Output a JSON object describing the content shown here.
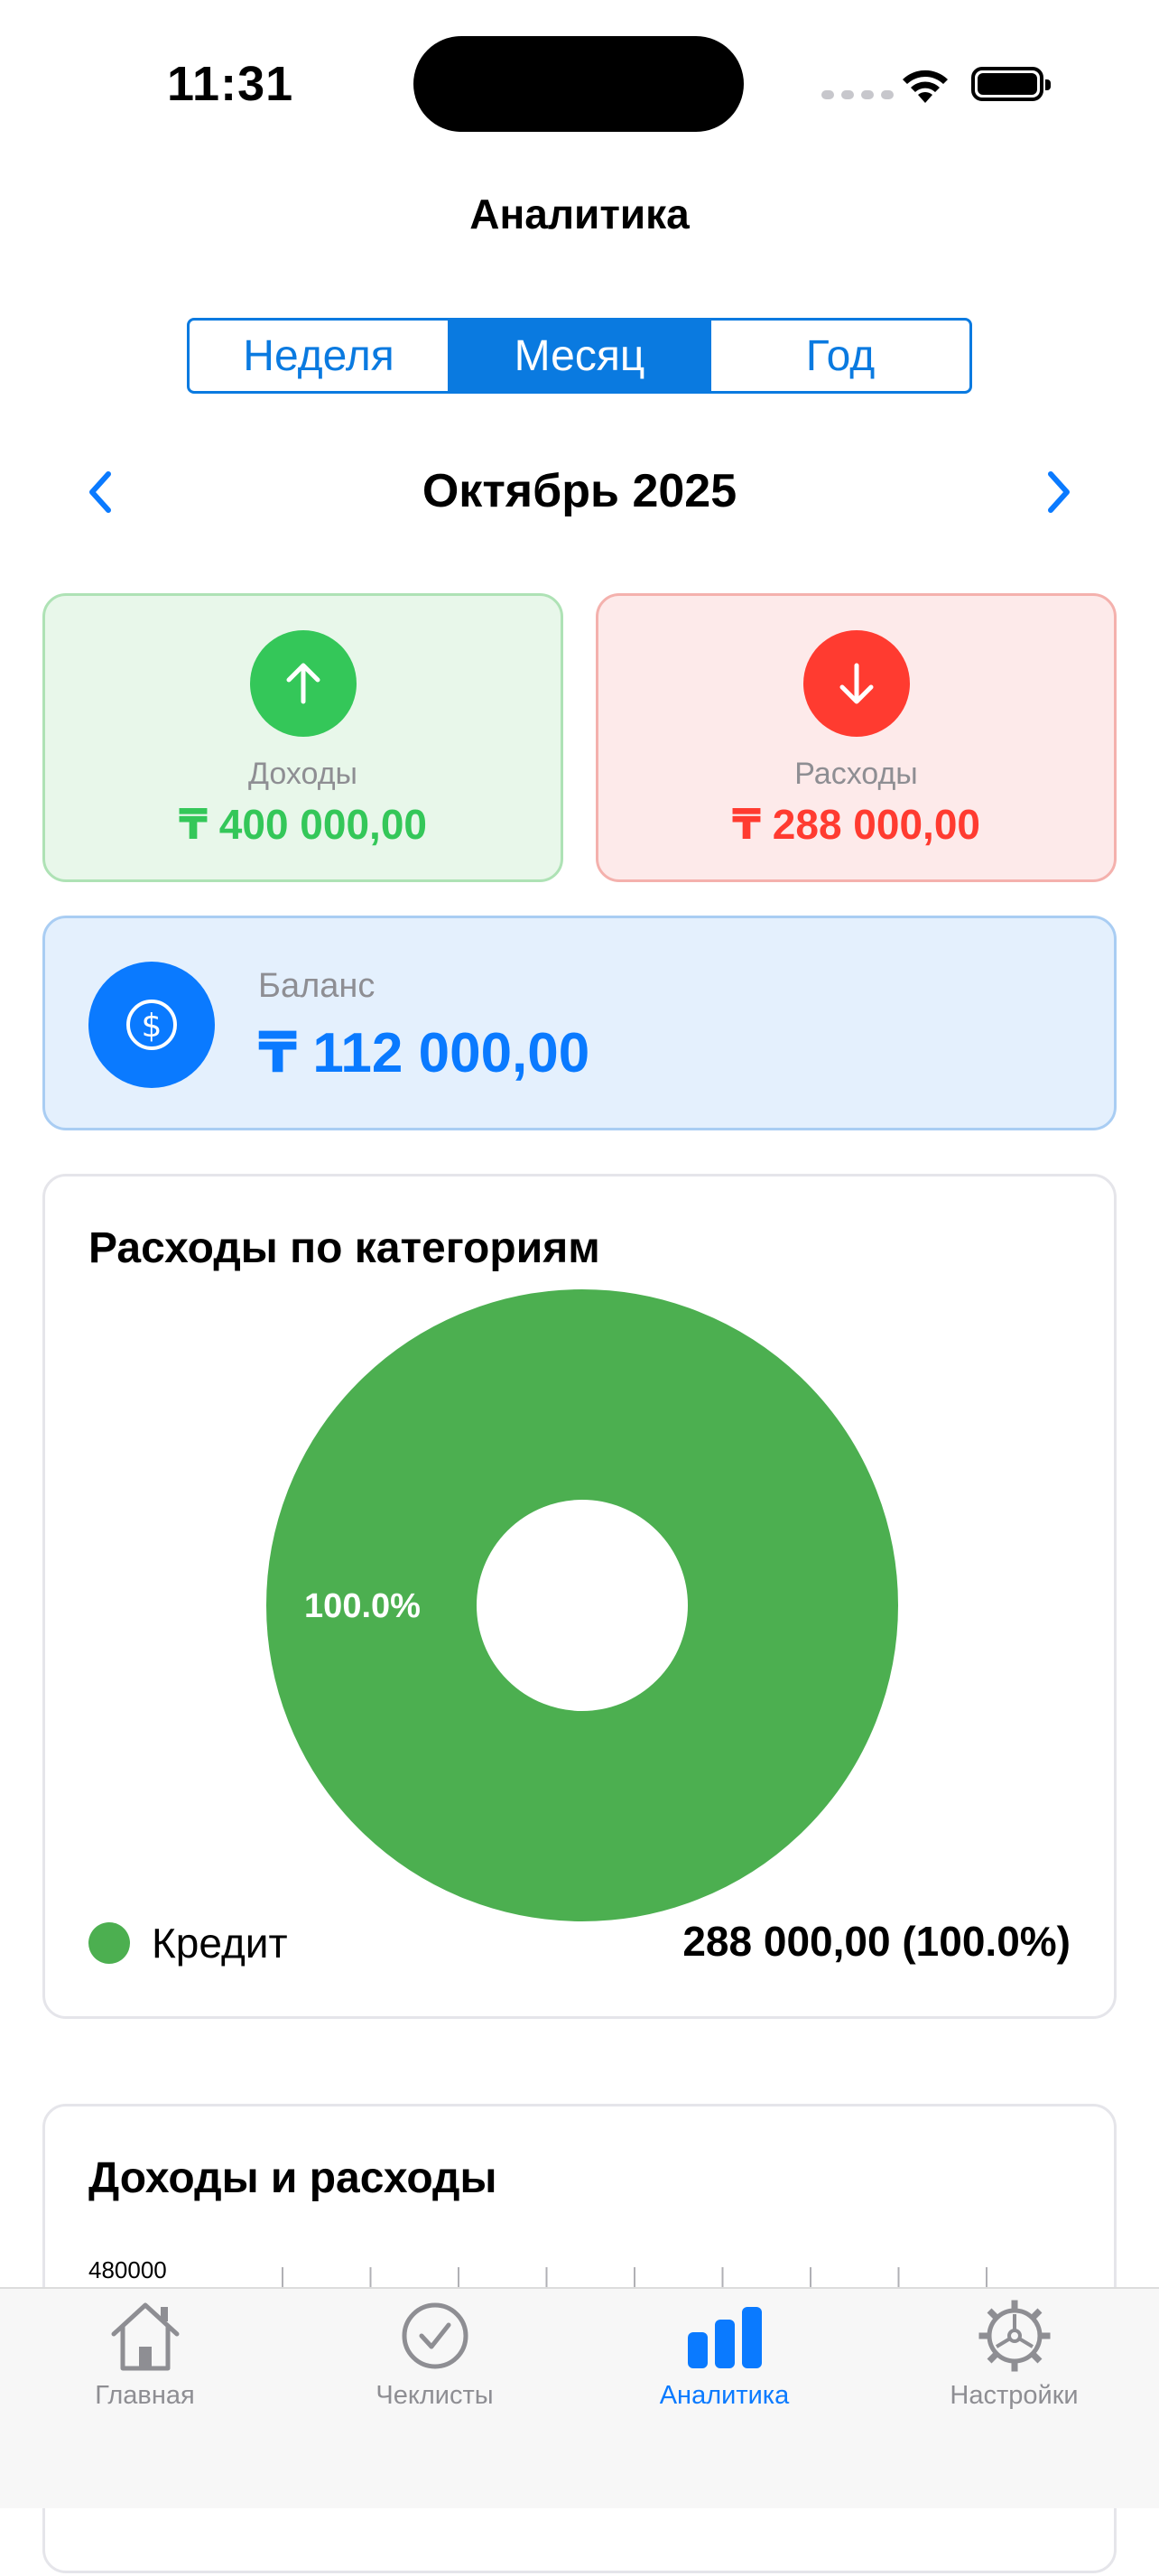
{
  "status_bar": {
    "time": "11:31"
  },
  "header": {
    "title": "Аналитика"
  },
  "period_picker": {
    "options": [
      "Неделя",
      "Месяц",
      "Год"
    ],
    "selected": "Месяц"
  },
  "month_nav": {
    "label": "Октябрь 2025"
  },
  "summary": {
    "income_label": "Доходы",
    "income_value": "₸ 400 000,00",
    "expense_label": "Расходы",
    "expense_value": "₸ 288 000,00",
    "balance_label": "Баланс",
    "balance_value": "₸ 112 000,00"
  },
  "category_chart": {
    "title": "Расходы по категориям",
    "legend": [
      {
        "name": "Кредит",
        "value": "288 000,00 (100.0%)"
      }
    ]
  },
  "income_expense_chart": {
    "title": "Доходы и расходы",
    "y_tick": "480000"
  },
  "chart_data": [
    {
      "type": "pie",
      "title": "Расходы по категориям",
      "categories": [
        "Кредит"
      ],
      "values": [
        288000
      ],
      "slice_labels": [
        "100.0%"
      ],
      "colors": [
        "#4caf50"
      ],
      "donut": true
    },
    {
      "type": "bar",
      "title": "Доходы и расходы",
      "y_ticks": [
        480000
      ]
    }
  ],
  "tab_bar": {
    "items": [
      {
        "label": "Главная",
        "icon": "house-icon",
        "active": false
      },
      {
        "label": "Чеклисты",
        "icon": "checkmark-circle-icon",
        "active": false
      },
      {
        "label": "Аналитика",
        "icon": "chart-bar-icon",
        "active": true
      },
      {
        "label": "Настройки",
        "icon": "gear-icon",
        "active": false
      }
    ]
  },
  "colors": {
    "accent": "#0a7aff",
    "income": "#34c759",
    "expense": "#ff3b30",
    "category_credit": "#4caf50"
  }
}
